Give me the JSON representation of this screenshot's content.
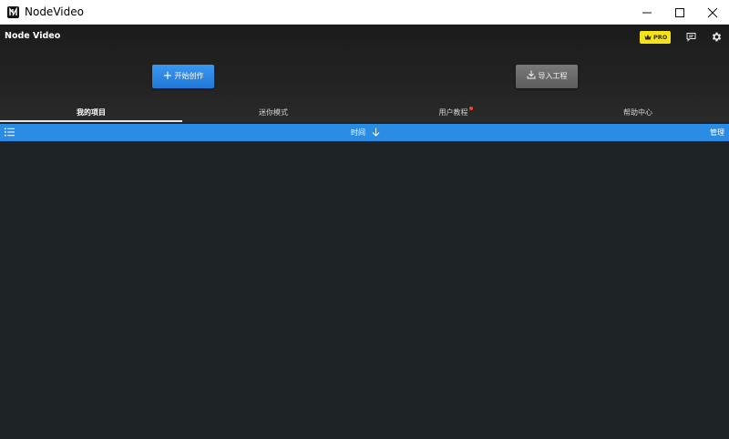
{
  "window": {
    "title": "NodeVideo"
  },
  "header": {
    "brand": "Node Video",
    "pro_label": "PRO",
    "accent_color": "#2b8ce6",
    "pro_color": "#f5e21a"
  },
  "actions": {
    "start_create": "开始创作",
    "import_project": "导入工程"
  },
  "tabs": [
    {
      "label": "我的项目",
      "active": true
    },
    {
      "label": "迷你模式",
      "active": false
    },
    {
      "label": "用户教程",
      "active": false,
      "badge": true
    },
    {
      "label": "帮助中心",
      "active": false
    }
  ],
  "sortbar": {
    "sort_label": "时间",
    "manage_label": "管理"
  },
  "icons": {
    "logo": "app-logo-icon",
    "feedback": "message-icon",
    "settings": "gear-icon",
    "list": "list-icon",
    "sort": "arrow-down-icon"
  }
}
